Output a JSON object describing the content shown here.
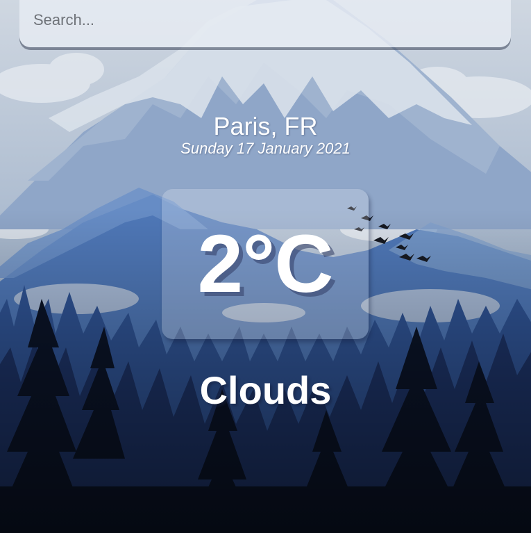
{
  "search": {
    "placeholder": "Search...",
    "value": ""
  },
  "location": {
    "city": "Paris, FR",
    "date": "Sunday 17 January 2021"
  },
  "weather": {
    "temperature": "2°C",
    "condition": "Clouds"
  },
  "theme": {
    "sky_top": "#c9d3de",
    "mountain": "#5b86c4",
    "forest_dark": "#0e1b33",
    "text": "#ffffff"
  }
}
